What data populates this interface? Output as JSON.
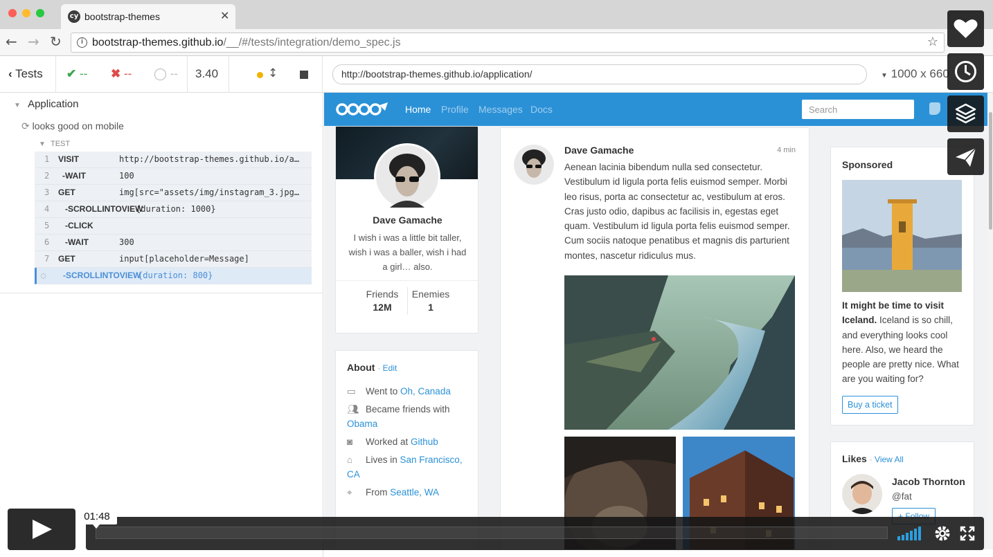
{
  "browser": {
    "tab_title": "bootstrap-themes",
    "favicon_text": "cy",
    "url_host": "bootstrap-themes.github.io",
    "url_path": "/__/#/tests/integration/demo_spec.js"
  },
  "cypress": {
    "back_label": "Tests",
    "passed": "--",
    "failed": "--",
    "pending": "--",
    "duration": "3.40",
    "app_url": "http://bootstrap-themes.github.io/application/",
    "viewport": "1000 x 660"
  },
  "reporter": {
    "suite": "Application",
    "test": "looks good on mobile",
    "section": "TEST",
    "commands": [
      {
        "num": "1",
        "name": "VISIT",
        "msg": "http://bootstrap-themes.github.io/a…"
      },
      {
        "num": "2",
        "name": "-WAIT",
        "msg": "100"
      },
      {
        "num": "3",
        "name": "GET",
        "msg": "img[src=\"assets/img/instagram_3.jpg…"
      },
      {
        "num": "4",
        "name": "-SCROLLINTOVIEW",
        "msg": "{duration: 1000}"
      },
      {
        "num": "5",
        "name": "-CLICK",
        "msg": ""
      },
      {
        "num": "6",
        "name": "-WAIT",
        "msg": "300"
      },
      {
        "num": "7",
        "name": "GET",
        "msg": "input[placeholder=Message]"
      },
      {
        "num": "",
        "name": "-SCROLLINTOVIEW",
        "msg": "{duration: 800}"
      }
    ]
  },
  "app": {
    "nav": [
      "Home",
      "Profile",
      "Messages",
      "Docs"
    ],
    "search_placeholder": "Search",
    "profile": {
      "name": "Dave Gamache",
      "bio": "I wish i was a little bit taller, wish i was a baller, wish i had a girl… also.",
      "friends_label": "Friends",
      "friends_value": "12M",
      "enemies_label": "Enemies",
      "enemies_value": "1"
    },
    "about": {
      "title": "About",
      "edit": "Edit",
      "went_to_prefix": "Went to ",
      "went_to_link": "Oh, Canada",
      "friends_prefix": "Became friends with ",
      "friends_link": "Obama",
      "worked_prefix": "Worked at ",
      "worked_link": "Github",
      "lives_prefix": "Lives in ",
      "lives_link": "San Francisco, CA",
      "from_prefix": "From ",
      "from_link": "Seattle, WA"
    },
    "post": {
      "author": "Dave Gamache",
      "time": "4 min",
      "body": "Aenean lacinia bibendum nulla sed consectetur. Vestibulum id ligula porta felis euismod semper. Morbi leo risus, porta ac consectetur ac, vestibulum at eros. Cras justo odio, dapibus ac facilisis in, egestas eget quam. Vestibulum id ligula porta felis euismod semper. Cum sociis natoque penatibus et magnis dis parturient montes, nascetur ridiculus mus."
    },
    "sponsored": {
      "title": "Sponsored",
      "bold": "It might be time to visit Iceland.",
      "text": " Iceland is so chill, and everything looks cool here. Also, we heard the people are pretty nice. What are you waiting for?",
      "button": "Buy a ticket"
    },
    "likes": {
      "title": "Likes",
      "view_all": "View All",
      "person": "Jacob Thornton",
      "handle": "@fat",
      "follow": "Follow"
    }
  },
  "video": {
    "time": "01:48"
  }
}
